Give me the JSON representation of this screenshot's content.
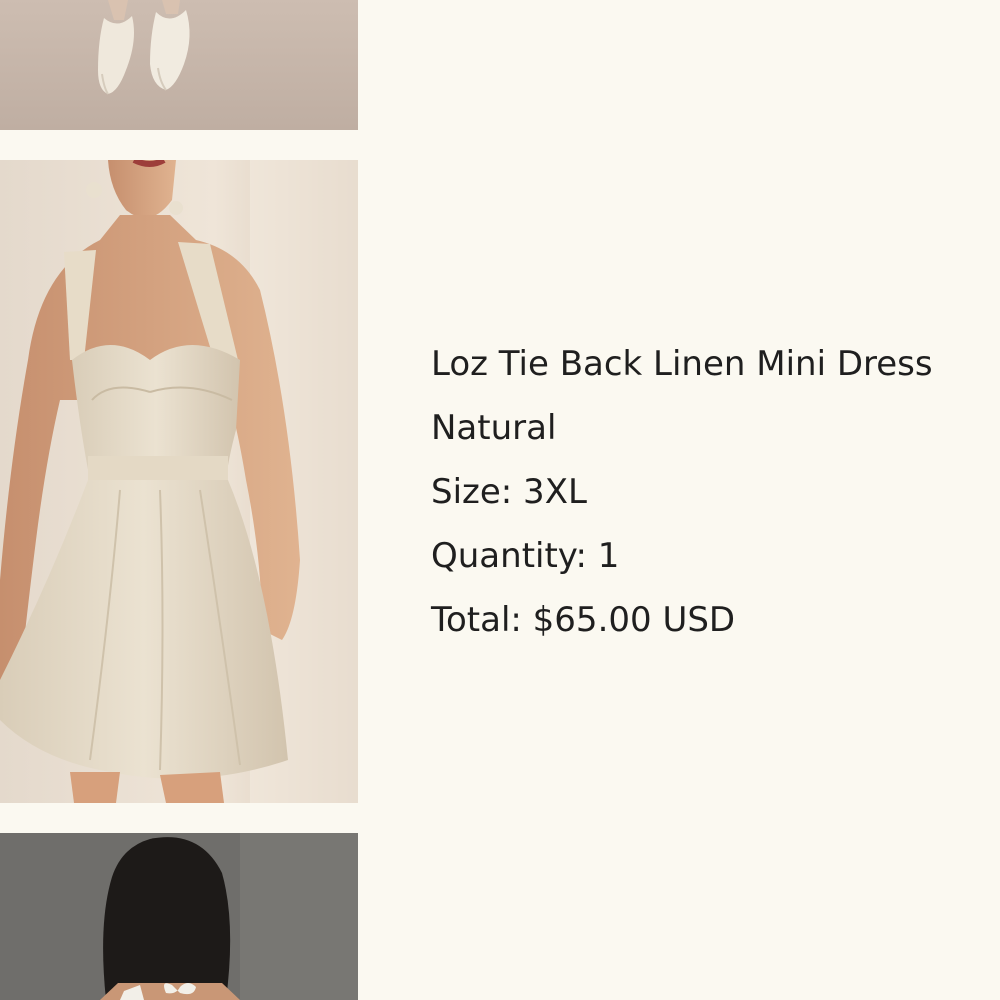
{
  "product": {
    "name": "Loz Tie Back Linen Mini Dress",
    "color": "Natural",
    "size": "Size: 3XL",
    "quantity": "Quantity: 1",
    "total": "Total: $65.00 USD"
  },
  "gallery": {
    "images": [
      {
        "subject": "cream pointed-toe mules"
      },
      {
        "subject": "woman wearing natural linen mini dress"
      },
      {
        "subject": "woman with tie back, rear view"
      }
    ]
  }
}
